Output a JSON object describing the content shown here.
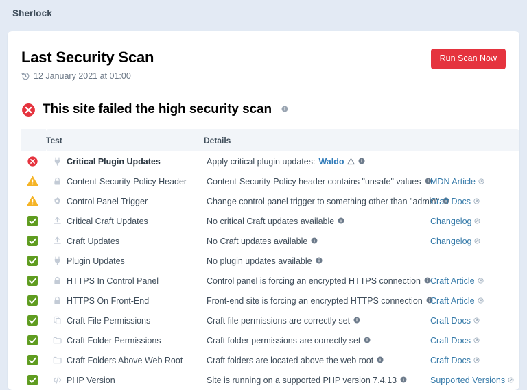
{
  "app": {
    "title": "Sherlock"
  },
  "header": {
    "title": "Last Security Scan",
    "timestamp": "12 January 2021 at 01:00",
    "timestamp_icon": "history-icon",
    "run_scan_label": "Run Scan Now",
    "accent_red": "#e5333e"
  },
  "verdict": {
    "status": "fail",
    "status_icon": "circle-x-icon",
    "text": "This site failed the high security scan",
    "info_icon": "info-icon"
  },
  "table": {
    "columns": {
      "status": "",
      "test": "Test",
      "details": "Details",
      "link": ""
    },
    "rows": [
      {
        "status": "fail",
        "status_icon": "circle-x-icon",
        "test_icon": "plug-icon",
        "test": "Critical Plugin Updates",
        "test_bold": true,
        "details": "Apply critical plugin updates:",
        "details_link": "Waldo",
        "details_warn_icon": "warning-triangle-icon",
        "info_icon": "info-icon",
        "link": "",
        "link_icon": ""
      },
      {
        "status": "warn",
        "status_icon": "warning-triangle-icon",
        "test_icon": "lock-icon",
        "test": "Content-Security-Policy Header",
        "test_bold": false,
        "details": "Content-Security-Policy header contains \"unsafe\" values",
        "details_link": "",
        "info_icon": "info-icon",
        "link": "MDN Article",
        "link_icon": "external-link-icon"
      },
      {
        "status": "warn",
        "status_icon": "warning-triangle-icon",
        "test_icon": "gear-icon",
        "test": "Control Panel Trigger",
        "test_bold": false,
        "details": "Change control panel trigger to something other than \"admin\"",
        "details_link": "",
        "info_icon": "info-icon",
        "link": "Craft Docs",
        "link_icon": "external-link-icon"
      },
      {
        "status": "pass",
        "status_icon": "check-square-icon",
        "test_icon": "upload-icon",
        "test": "Critical Craft Updates",
        "test_bold": false,
        "details": "No critical Craft updates available",
        "details_link": "",
        "info_icon": "info-icon",
        "link": "Changelog",
        "link_icon": "external-link-icon"
      },
      {
        "status": "pass",
        "status_icon": "check-square-icon",
        "test_icon": "upload-icon",
        "test": "Craft Updates",
        "test_bold": false,
        "details": "No Craft updates available",
        "details_link": "",
        "info_icon": "info-icon",
        "link": "Changelog",
        "link_icon": "external-link-icon"
      },
      {
        "status": "pass",
        "status_icon": "check-square-icon",
        "test_icon": "plug-icon",
        "test": "Plugin Updates",
        "test_bold": false,
        "details": "No plugin updates available",
        "details_link": "",
        "info_icon": "info-icon",
        "link": "",
        "link_icon": ""
      },
      {
        "status": "pass",
        "status_icon": "check-square-icon",
        "test_icon": "lock-icon",
        "test": "HTTPS In Control Panel",
        "test_bold": false,
        "details": "Control panel is forcing an encrypted HTTPS connection",
        "details_link": "",
        "info_icon": "info-icon",
        "link": "Craft Article",
        "link_icon": "external-link-icon"
      },
      {
        "status": "pass",
        "status_icon": "check-square-icon",
        "test_icon": "lock-icon",
        "test": "HTTPS On Front-End",
        "test_bold": false,
        "details": "Front-end site is forcing an encrypted HTTPS connection",
        "details_link": "",
        "info_icon": "info-icon",
        "link": "Craft Article",
        "link_icon": "external-link-icon"
      },
      {
        "status": "pass",
        "status_icon": "check-square-icon",
        "test_icon": "file-copy-icon",
        "test": "Craft File Permissions",
        "test_bold": false,
        "details": "Craft file permissions are correctly set",
        "details_link": "",
        "info_icon": "info-icon",
        "link": "Craft Docs",
        "link_icon": "external-link-icon"
      },
      {
        "status": "pass",
        "status_icon": "check-square-icon",
        "test_icon": "folder-icon",
        "test": "Craft Folder Permissions",
        "test_bold": false,
        "details": "Craft folder permissions are correctly set",
        "details_link": "",
        "info_icon": "info-icon",
        "link": "Craft Docs",
        "link_icon": "external-link-icon"
      },
      {
        "status": "pass",
        "status_icon": "check-square-icon",
        "test_icon": "folder-icon",
        "test": "Craft Folders Above Web Root",
        "test_bold": false,
        "details": "Craft folders are located above the web root",
        "details_link": "",
        "info_icon": "info-icon",
        "link": "Craft Docs",
        "link_icon": "external-link-icon"
      },
      {
        "status": "pass",
        "status_icon": "check-square-icon",
        "test_icon": "code-icon",
        "test": "PHP Version",
        "test_bold": false,
        "details": "Site is running on a supported PHP version 7.4.13",
        "details_link": "",
        "info_icon": "info-icon",
        "link": "Supported Versions",
        "link_icon": "external-link-icon"
      }
    ]
  },
  "colors": {
    "page_bg": "#e3eaf4",
    "card_bg": "#ffffff",
    "fail": "#e5333e",
    "warn": "#f5b427",
    "pass": "#5f9c20",
    "link": "#3479a8",
    "text": "#3f4d5a"
  }
}
